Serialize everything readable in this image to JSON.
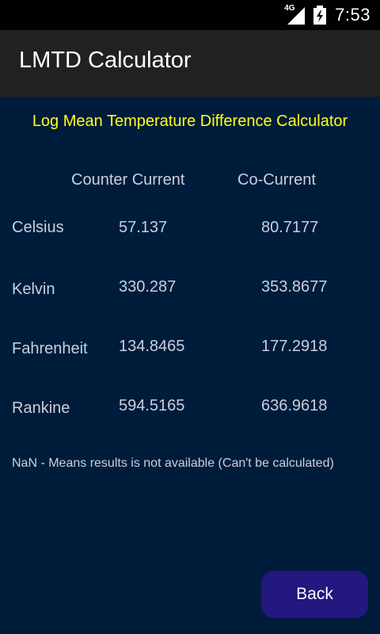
{
  "status_bar": {
    "network_label": "4G",
    "time": "7:53",
    "icons": [
      "signal-icon",
      "battery-icon"
    ]
  },
  "app_bar": {
    "title": "LMTD Calculator"
  },
  "main": {
    "subtitle": "Log Mean Temperature Difference Calculator",
    "columns": [
      "Counter Current",
      "Co-Current"
    ],
    "rows": [
      {
        "label": "Celsius",
        "counter_current": "57.137",
        "co_current": "80.7177"
      },
      {
        "label": "Kelvin",
        "counter_current": "330.287",
        "co_current": "353.8677"
      },
      {
        "label": "Fahrenheit",
        "counter_current": "134.8465",
        "co_current": "177.2918"
      },
      {
        "label": "Rankine",
        "counter_current": "594.5165",
        "co_current": "636.9618"
      }
    ],
    "note": "NaN - Means results is not available (Can't be calculated)",
    "back_button_label": "Back"
  },
  "colors": {
    "content_bg": "#001c3b",
    "subtitle": "#ffff19",
    "button_bg": "#22187f",
    "appbar_bg": "#212121"
  }
}
